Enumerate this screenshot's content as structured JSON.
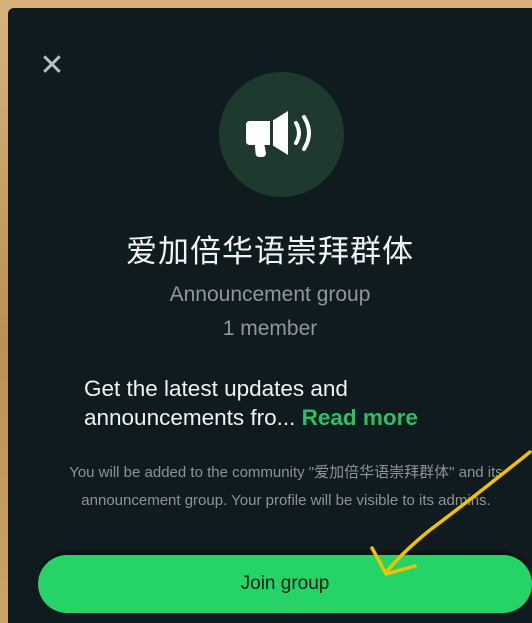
{
  "dialog": {
    "close_icon": "close-icon",
    "avatar_icon": "megaphone-icon",
    "title": "爱加倍华语崇拜群体",
    "subtitle": "Announcement group",
    "member_count": "1 member",
    "description": "Get the latest updates and announcements fro...",
    "read_more": "Read more",
    "notice": "You will be added to the community \"爱加倍华语崇拜群体\" and its announcement group. Your profile will be visible to its admins.",
    "join_button": "Join group"
  },
  "colors": {
    "background": "#101b1f",
    "accent": "#25d366",
    "avatar_bg": "#1e3a2e",
    "annotation_arrow": "#f2c200"
  }
}
